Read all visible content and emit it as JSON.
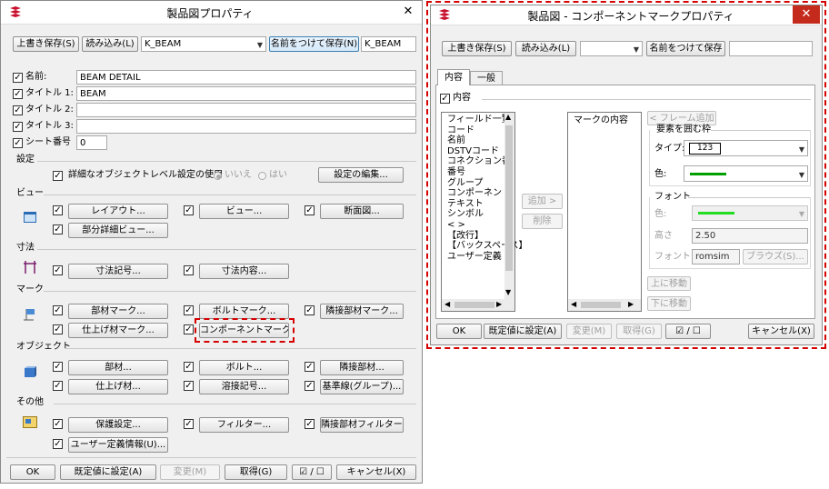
{
  "left": {
    "title": "製品図プロパティ",
    "overwrite_save": "上書き保存(S)",
    "load": "読み込み(L)",
    "preset": "K_BEAM",
    "save_as": "名前をつけて保存(N)",
    "save_as_name": "K_BEAM",
    "fields": [
      {
        "label": "名前:",
        "value": "BEAM DETAIL"
      },
      {
        "label": "タイトル 1:",
        "value": "BEAM"
      },
      {
        "label": "タイトル 2:",
        "value": ""
      },
      {
        "label": "タイトル 3:",
        "value": ""
      },
      {
        "label": "シート番号",
        "value": "0"
      }
    ],
    "settings": {
      "heading": "設定",
      "detail_label": "詳細なオブジェクトレベル設定の使用",
      "no": "いいえ",
      "yes": "はい",
      "edit": "設定の編集..."
    },
    "view": {
      "heading": "ビュー",
      "layout": "レイアウト...",
      "view": "ビュー...",
      "section": "断面図...",
      "partial": "部分詳細ビュー..."
    },
    "dim": {
      "heading": "寸法",
      "symbol": "寸法記号...",
      "content": "寸法内容..."
    },
    "mark": {
      "heading": "マーク",
      "part": "部材マーク...",
      "bolt": "ボルトマーク...",
      "adjacent": "隣接部材マーク...",
      "finish": "仕上げ材マーク...",
      "component": "コンポーネントマーク..."
    },
    "object": {
      "heading": "オブジェクト",
      "part": "部材...",
      "bolt": "ボルト...",
      "adjacent": "隣接部材...",
      "finish": "仕上げ材...",
      "weld": "溶接記号...",
      "grid": "基準線(グループ)..."
    },
    "other": {
      "heading": "その他",
      "protect": "保護設定...",
      "filter": "フィルター...",
      "adjfilter": "隣接部材フィルター...",
      "userinfo": "ユーザー定義情報(U)..."
    },
    "bottom": {
      "ok": "OK",
      "default": "既定値に設定(A)",
      "modify": "変更(M)",
      "get": "取得(G)",
      "toggle": "☑ / ☐",
      "cancel": "キャンセル(X)"
    }
  },
  "right": {
    "title": "製品図 - コンポーネントマークプロパティ",
    "overwrite_save": "上書き保存(S)",
    "load": "読み込み(L)",
    "preset": "",
    "save_as": "名前をつけて保存",
    "save_as_name": "",
    "tabs": [
      "内容",
      "一般"
    ],
    "content_label": "内容",
    "field_items": [
      "フィールド一覧",
      "コード",
      "名前",
      "DSTVコード",
      "コネクション番",
      "番号",
      "グループ",
      "コンポーネント",
      "テキスト",
      "シンボル",
      "< >",
      "【改行】",
      "【バックスペース】",
      "ユーザー定義"
    ],
    "mark_content_header": "マークの内容",
    "add": "追加 >",
    "delete": "削除",
    "frame_add": "< フレーム追加",
    "enclosing_frame": "要素を囲む枠",
    "type_label": "タイプ:",
    "type_value": "123",
    "color_label": "色:",
    "font_group": "フォント",
    "font_color_label": "色:",
    "height_label": "高さ",
    "height_value": "2.50",
    "font_label": "フォント:",
    "font_value": "romsim",
    "browse": "ブラウズ(S)...",
    "move_up": "上に移動",
    "move_down": "下に移動",
    "bottom": {
      "ok": "OK",
      "default": "既定値に設定(A)",
      "modify": "変更(M)",
      "get": "取得(G)",
      "toggle": "☑ / ☐",
      "cancel": "キャンセル(X)"
    }
  },
  "colors": {
    "accent_red": "#d50000",
    "close_red": "#c42b1c",
    "line_green": "#009f00",
    "font_green": "#22dd22"
  }
}
